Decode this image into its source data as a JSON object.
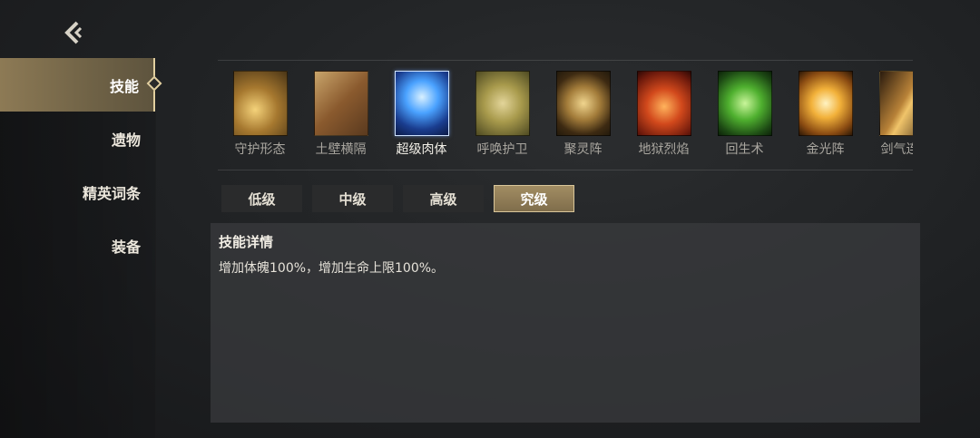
{
  "sidebar": {
    "items": [
      {
        "label": "技能"
      },
      {
        "label": "遗物"
      },
      {
        "label": "精英词条"
      },
      {
        "label": "装备"
      }
    ]
  },
  "skills": [
    {
      "name": "守护形态",
      "icon": "golden-wind-icon"
    },
    {
      "name": "土壁横隔",
      "icon": "earth-wall-icon"
    },
    {
      "name": "超级肉体",
      "icon": "blue-titan-icon"
    },
    {
      "name": "呼唤护卫",
      "icon": "summon-guard-icon"
    },
    {
      "name": "聚灵阵",
      "icon": "spirit-circle-icon"
    },
    {
      "name": "地狱烈焰",
      "icon": "hell-flame-icon"
    },
    {
      "name": "回生术",
      "icon": "revive-icon"
    },
    {
      "name": "金光阵",
      "icon": "golden-light-icon"
    },
    {
      "name": "剑气连斩",
      "icon": "sword-slash-icon"
    }
  ],
  "tiers": [
    {
      "label": "低级"
    },
    {
      "label": "中级"
    },
    {
      "label": "高级"
    },
    {
      "label": "究级"
    }
  ],
  "detail": {
    "title": "技能详情",
    "text": "增加体魄100%，增加生命上限100%。"
  }
}
